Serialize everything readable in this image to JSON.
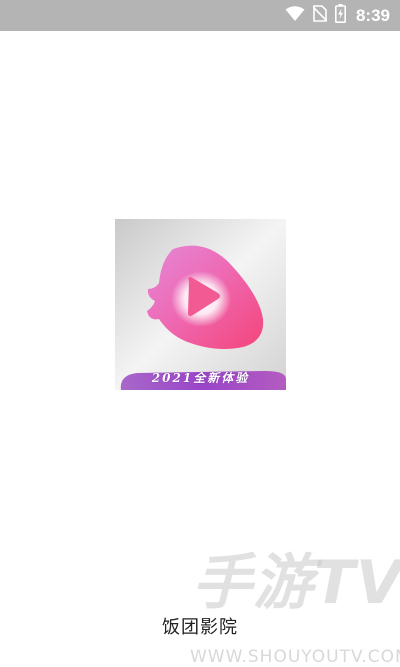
{
  "status_bar": {
    "time": "8:39",
    "icons": [
      "wifi-icon",
      "no-sim-icon",
      "battery-charging-icon"
    ]
  },
  "splash": {
    "logo_icon": "play-logo-icon",
    "slogan": "2021全新体验",
    "app_name": "饭团影院"
  },
  "watermark": {
    "logo_text": "手游TV",
    "url": "WWW.SHOUYOUTV.COM"
  },
  "colors": {
    "status_bar_bg": "#b4b4b4",
    "logo_pink": "#f0589a",
    "logo_violet": "#e07ad4",
    "slogan_band": "#9a45c8"
  }
}
